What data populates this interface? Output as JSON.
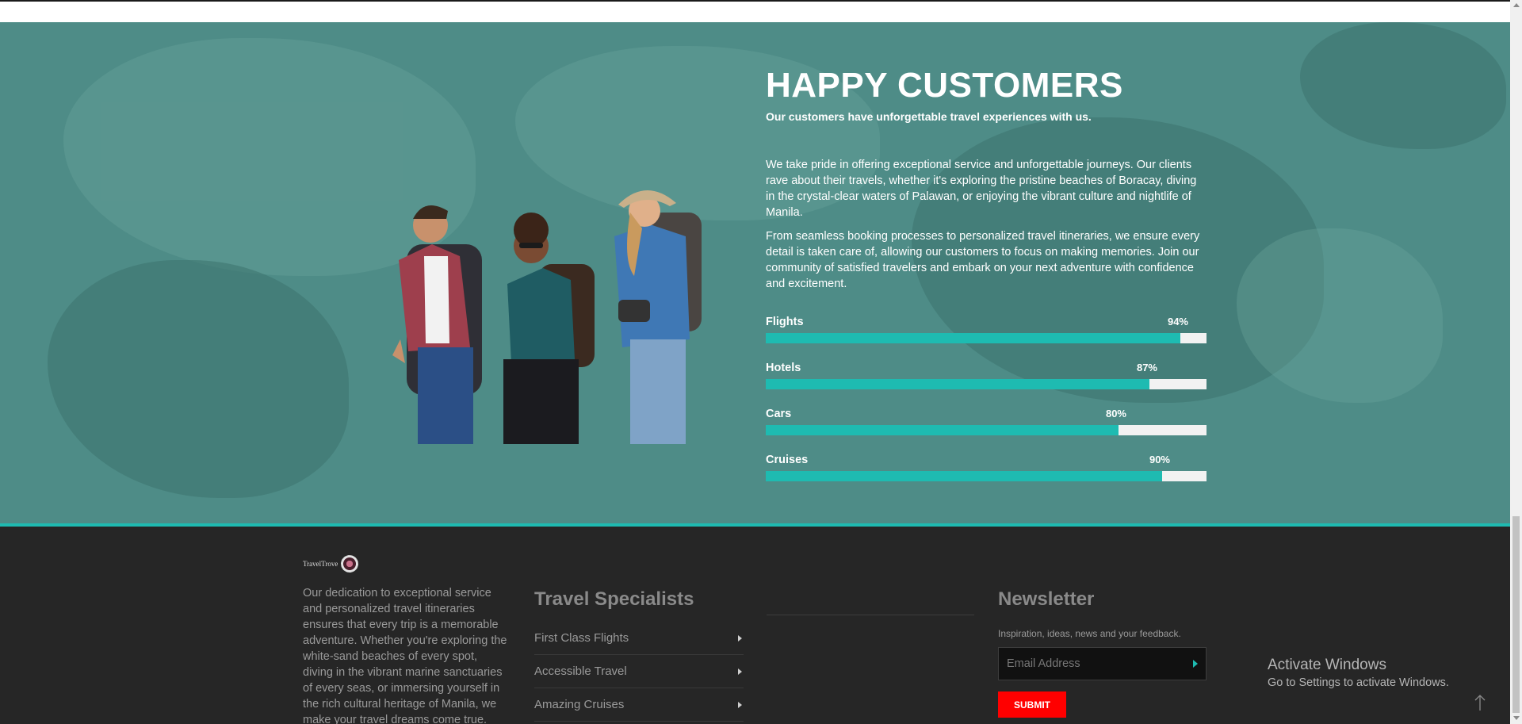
{
  "colors": {
    "hero_bg": "#4e8c87",
    "accent": "#1ebbb1",
    "footer_bg": "#262626",
    "submit": "#ff0000"
  },
  "hero": {
    "title": "HAPPY CUSTOMERS",
    "subtitle": "Our customers have unforgettable travel experiences with us.",
    "paragraphs": [
      "We take pride in offering exceptional service and unforgettable journeys. Our clients rave about their travels, whether it's exploring the pristine beaches of Boracay, diving in the crystal-clear waters of Palawan, or enjoying the vibrant culture and nightlife of Manila.",
      "From seamless booking processes to personalized travel itineraries, we ensure every detail is taken care of, allowing our customers to focus on making memories. Join our community of satisfied travelers and embark on your next adventure with confidence and excitement."
    ],
    "bars": [
      {
        "label": "Flights",
        "value": 94,
        "display": "94%"
      },
      {
        "label": "Hotels",
        "value": 87,
        "display": "87%"
      },
      {
        "label": "Cars",
        "value": 80,
        "display": "80%"
      },
      {
        "label": "Cruises",
        "value": 90,
        "display": "90%"
      }
    ]
  },
  "footer": {
    "logo_text": "TravelTrove",
    "about": "Our dedication to exceptional service and personalized travel itineraries ensures that every trip is a memorable adventure. Whether you're exploring the white-sand beaches of every spot, diving in the vibrant marine sanctuaries of every seas, or immersing yourself in the rich cultural heritage of Manila, we make your travel dreams come true.",
    "specialists": {
      "title": "Travel Specialists",
      "links": [
        "First Class Flights",
        "Accessible Travel",
        "Amazing Cruises"
      ]
    },
    "newsletter": {
      "title": "Newsletter",
      "text": "Inspiration, ideas, news and your feedback.",
      "email_placeholder": "Email Address",
      "submit_label": "SUBMIT"
    }
  },
  "windows_watermark": {
    "title": "Activate Windows",
    "subtitle": "Go to Settings to activate Windows."
  }
}
